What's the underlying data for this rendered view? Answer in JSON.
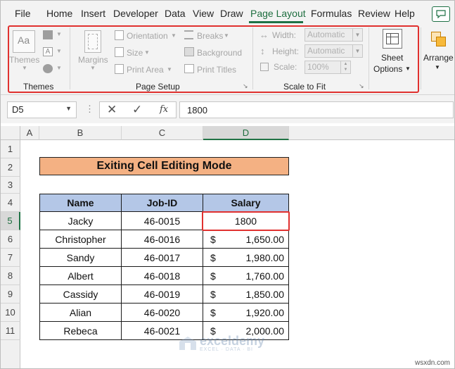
{
  "tabs": [
    "File",
    "Home",
    "Insert",
    "Developer",
    "Data",
    "View",
    "Draw",
    "Page Layout",
    "Formulas",
    "Review",
    "Help"
  ],
  "active_tab": "Page Layout",
  "ribbon": {
    "themes": {
      "label": "Themes",
      "group": "Themes"
    },
    "page_setup": {
      "margins": "Margins",
      "orientation": "Orientation",
      "size": "Size",
      "print_area": "Print Area",
      "breaks": "Breaks",
      "background": "Background",
      "print_titles": "Print Titles",
      "group": "Page Setup"
    },
    "scale_to_fit": {
      "width_label": "Width:",
      "width_value": "Automatic",
      "height_label": "Height:",
      "height_value": "Automatic",
      "scale_label": "Scale:",
      "scale_value": "100%",
      "group": "Scale to Fit"
    },
    "sheet_options": {
      "line1": "Sheet",
      "line2": "Options"
    },
    "arrange": "Arrange"
  },
  "formula_bar": {
    "name_box": "D5",
    "fx": "fx",
    "value": "1800"
  },
  "columns": [
    "A",
    "B",
    "C",
    "D"
  ],
  "rows": [
    "1",
    "2",
    "3",
    "4",
    "5",
    "6",
    "7",
    "8",
    "9",
    "10",
    "11"
  ],
  "sheet": {
    "title": "Exiting Cell Editing Mode",
    "headers": [
      "Name",
      "Job-ID",
      "Salary"
    ],
    "records": [
      {
        "name": "Jacky",
        "id": "46-0015",
        "currency": "",
        "salary": "1800"
      },
      {
        "name": "Christopher",
        "id": "46-0016",
        "currency": "$",
        "salary": "1,650.00"
      },
      {
        "name": "Sandy",
        "id": "46-0017",
        "currency": "$",
        "salary": "1,980.00"
      },
      {
        "name": "Albert",
        "id": "46-0018",
        "currency": "$",
        "salary": "1,760.00"
      },
      {
        "name": "Cassidy",
        "id": "46-0019",
        "currency": "$",
        "salary": "1,850.00"
      },
      {
        "name": "Alian",
        "id": "46-0020",
        "currency": "$",
        "salary": "1,920.00"
      },
      {
        "name": "Rebeca",
        "id": "46-0021",
        "currency": "$",
        "salary": "2,000.00"
      }
    ]
  },
  "watermark": {
    "name": "exceldemy",
    "tagline": "EXCEL · DATA · BI"
  },
  "site": "wsxdn.com",
  "colors": {
    "accent": "#217346",
    "highlight": "#e0312f",
    "title_fill": "#f4b183",
    "header_fill": "#b4c7e7"
  }
}
